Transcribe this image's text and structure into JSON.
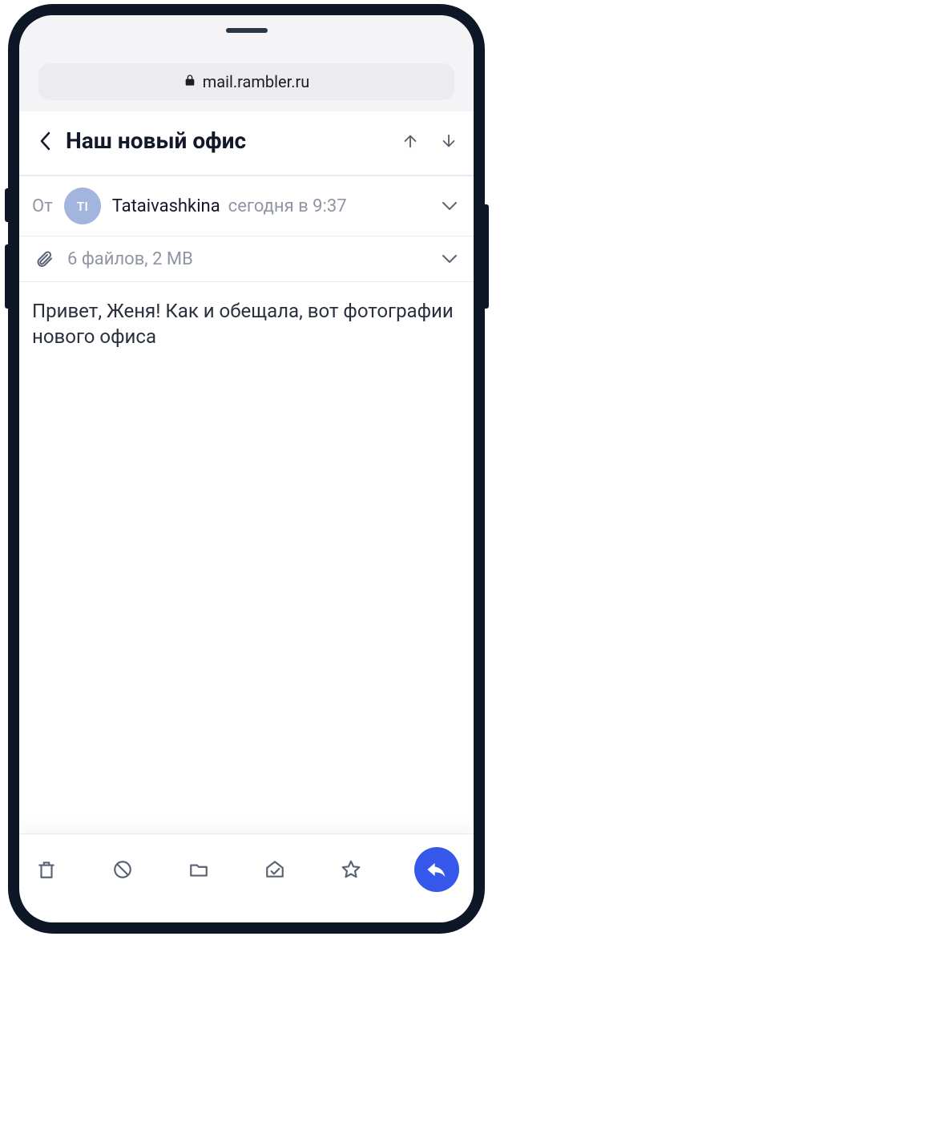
{
  "browser": {
    "url": "mail.rambler.ru"
  },
  "header": {
    "title": "Наш новый офис"
  },
  "sender": {
    "from_label": "От",
    "avatar_initials": "TI",
    "name": "Tataivashkina",
    "timestamp": "сегодня в 9:37"
  },
  "attachments": {
    "summary": "6 файлов, 2 MB"
  },
  "body": {
    "text": "Привет, Женя! Как и обещала, вот фотографии нового офиса"
  }
}
